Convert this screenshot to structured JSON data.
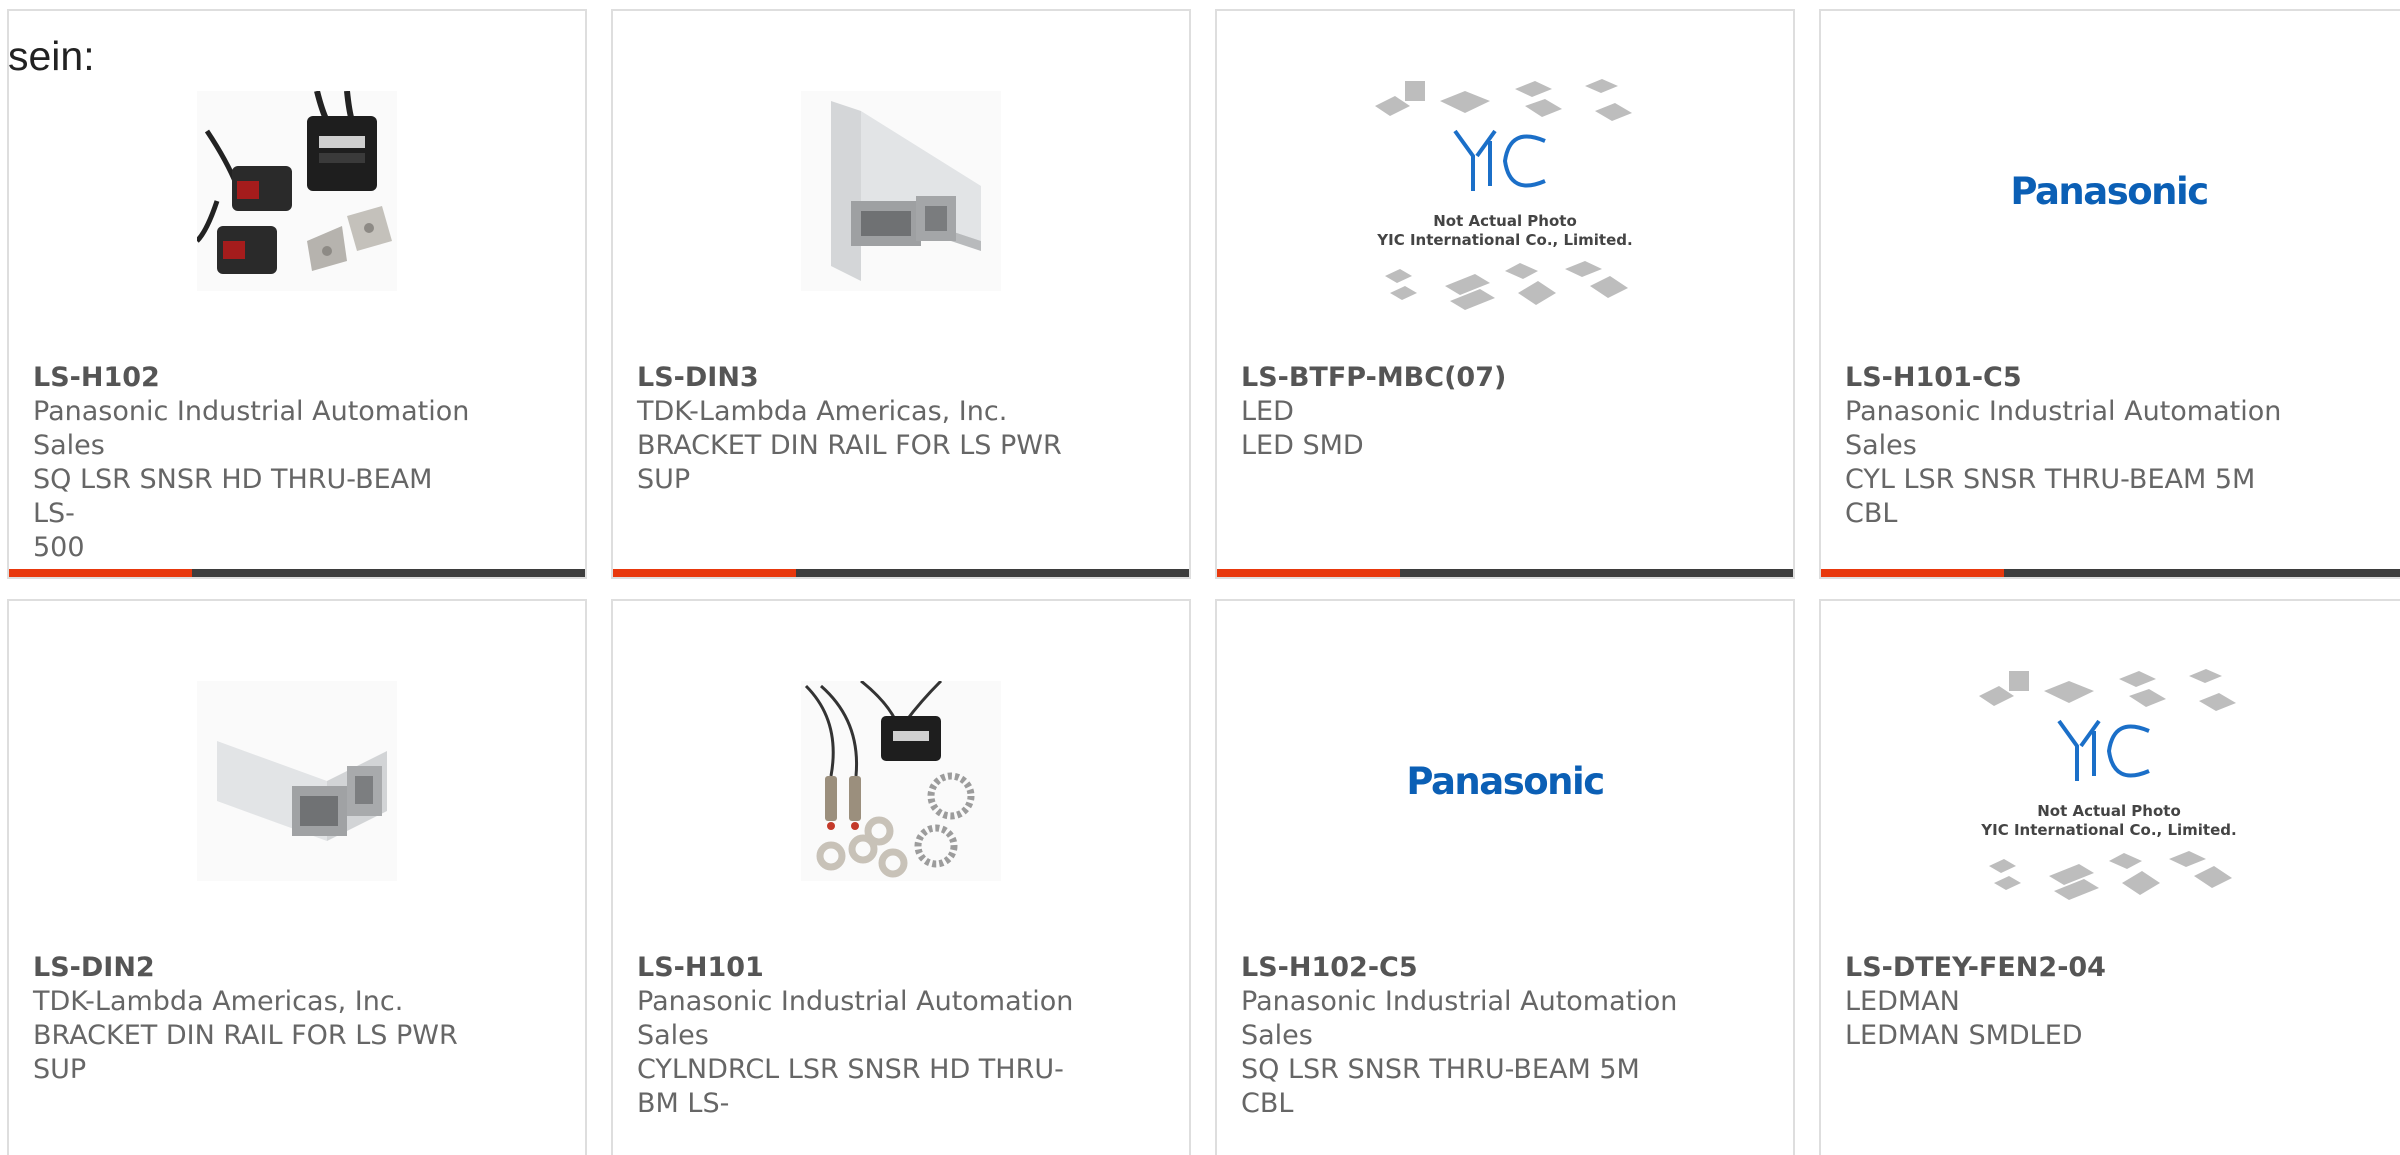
{
  "intro_text": "sein:",
  "colors": {
    "accent": "#e8380d",
    "bar": "#3d3d3d",
    "card_border": "#dedede",
    "text": "#666666",
    "panasonic_blue": "#0b5fb5"
  },
  "products": [
    {
      "part_number": "LS-H102",
      "manufacturer": "Panasonic Industrial Automation",
      "manufacturer_cont": "Sales",
      "description": "SQ LSR SNSR HD THRU-BEAM LS-",
      "description_cont": "500",
      "image": "sensor-photo-icon"
    },
    {
      "part_number": "LS-DIN3",
      "manufacturer": "TDK-Lambda Americas, Inc.",
      "manufacturer_cont": "",
      "description": "BRACKET DIN RAIL FOR LS PWR",
      "description_cont": "SUP",
      "image": "bracket-photo-icon"
    },
    {
      "part_number": "LS-BTFP-MBC(07)",
      "manufacturer": "LED",
      "manufacturer_cont": "",
      "description": "LED SMD",
      "description_cont": "",
      "image": "yic-placeholder-icon",
      "placeholder_line1": "Not Actual Photo",
      "placeholder_line2": "YIC International Co., Limited."
    },
    {
      "part_number": "LS-H101-C5",
      "manufacturer": "Panasonic Industrial Automation",
      "manufacturer_cont": "Sales",
      "description": "CYL LSR SNSR THRU-BEAM 5M",
      "description_cont": "CBL",
      "image": "panasonic-logo-icon",
      "logo_text": "Panasonic"
    },
    {
      "part_number": "LS-DIN2",
      "manufacturer": "TDK-Lambda Americas, Inc.",
      "manufacturer_cont": "",
      "description": "BRACKET DIN RAIL FOR LS PWR",
      "description_cont": "SUP",
      "image": "bracket-photo-icon"
    },
    {
      "part_number": "LS-H101",
      "manufacturer": "Panasonic Industrial Automation",
      "manufacturer_cont": "Sales",
      "description": "CYLNDRCL LSR SNSR HD THRU-",
      "description_cont": "BM LS-",
      "image": "cable-sensor-photo-icon"
    },
    {
      "part_number": "LS-H102-C5",
      "manufacturer": "Panasonic Industrial Automation",
      "manufacturer_cont": "Sales",
      "description": "SQ LSR SNSR THRU-BEAM 5M",
      "description_cont": "CBL",
      "image": "panasonic-logo-icon",
      "logo_text": "Panasonic"
    },
    {
      "part_number": "LS-DTEY-FEN2-04",
      "manufacturer": "LEDMAN",
      "manufacturer_cont": "",
      "description": "LEDMAN SMDLED",
      "description_cont": "",
      "image": "yic-placeholder-icon",
      "placeholder_line1": "Not Actual Photo",
      "placeholder_line2": "YIC International Co., Limited."
    }
  ]
}
